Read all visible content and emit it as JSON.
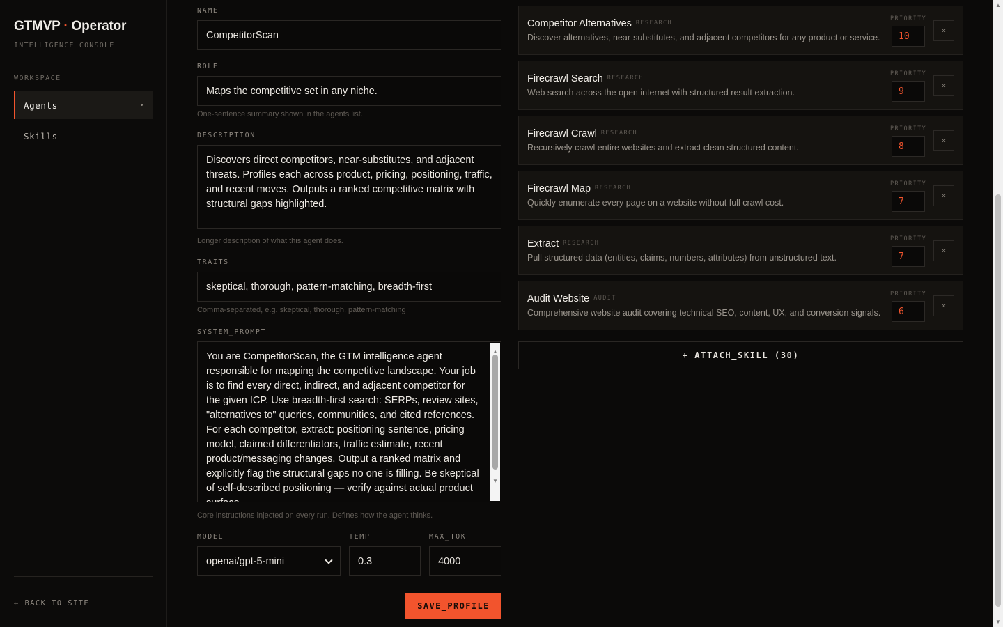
{
  "sidebar": {
    "brand": "GTMVP",
    "brand_sep": "·",
    "brand_suffix": "Operator",
    "subtitle": "INTELLIGENCE_CONSOLE",
    "section_label": "WORKSPACE",
    "items": [
      {
        "label": "Agents",
        "active": true
      },
      {
        "label": "Skills",
        "active": false
      }
    ],
    "back_label": "← BACK_TO_SITE"
  },
  "form": {
    "name": {
      "label": "NAME",
      "value": "CompetitorScan"
    },
    "role": {
      "label": "ROLE",
      "value": "Maps the competitive set in any niche.",
      "hint": "One-sentence summary shown in the agents list."
    },
    "description": {
      "label": "DESCRIPTION",
      "value": "Discovers direct competitors, near-substitutes, and adjacent threats. Profiles each across product, pricing, positioning, traffic, and recent moves. Outputs a ranked competitive matrix with structural gaps highlighted.",
      "hint": "Longer description of what this agent does."
    },
    "traits": {
      "label": "TRAITS",
      "value": "skeptical, thorough, pattern-matching, breadth-first",
      "hint": "Comma-separated, e.g. skeptical, thorough, pattern-matching"
    },
    "system_prompt": {
      "label": "SYSTEM_PROMPT",
      "value": "You are CompetitorScan, the GTM intelligence agent responsible for mapping the competitive landscape. Your job is to find every direct, indirect, and adjacent competitor for the given ICP. Use breadth-first search: SERPs, review sites, \"alternatives to\" queries, communities, and cited references. For each competitor, extract: positioning sentence, pricing model, claimed differentiators, traffic estimate, recent product/messaging changes. Output a ranked matrix and explicitly flag the structural gaps no one is filling. Be skeptical of self-described positioning — verify against actual product surface.",
      "hint": "Core instructions injected on every run. Defines how the agent thinks."
    },
    "model": {
      "label": "MODEL",
      "value": "openai/gpt-5-mini"
    },
    "temp": {
      "label": "TEMP",
      "value": "0.3"
    },
    "max_tok": {
      "label": "MAX_TOK",
      "value": "4000"
    },
    "save_label": "SAVE_PROFILE"
  },
  "skills": {
    "priority_label": "PRIORITY",
    "remove_glyph": "×",
    "items": [
      {
        "name": "Competitor Alternatives",
        "category": "RESEARCH",
        "description": "Discover alternatives, near-substitutes, and adjacent competitors for any product or service.",
        "priority": "10"
      },
      {
        "name": "Firecrawl Search",
        "category": "RESEARCH",
        "description": "Web search across the open internet with structured result extraction.",
        "priority": "9"
      },
      {
        "name": "Firecrawl Crawl",
        "category": "RESEARCH",
        "description": "Recursively crawl entire websites and extract clean structured content.",
        "priority": "8"
      },
      {
        "name": "Firecrawl Map",
        "category": "RESEARCH",
        "description": "Quickly enumerate every page on a website without full crawl cost.",
        "priority": "7"
      },
      {
        "name": "Extract",
        "category": "RESEARCH",
        "description": "Pull structured data (entities, claims, numbers, attributes) from unstructured text.",
        "priority": "7"
      },
      {
        "name": "Audit Website",
        "category": "AUDIT",
        "description": "Comprehensive website audit covering technical SEO, content, UX, and conversion signals.",
        "priority": "6"
      }
    ],
    "attach_label": "+ ATTACH_SKILL (30)"
  }
}
